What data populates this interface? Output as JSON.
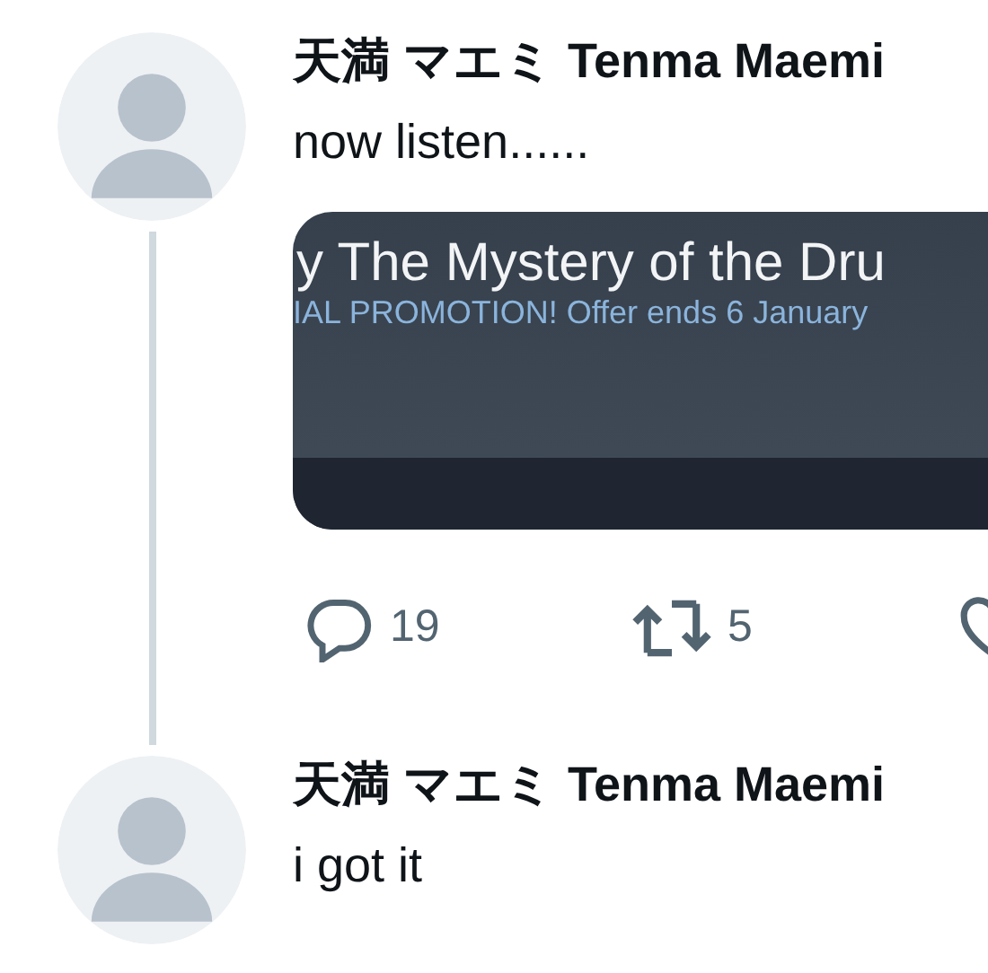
{
  "tweets": [
    {
      "author": "天満 マエミ Tenma Maemi",
      "text": "now listen......",
      "card": {
        "title": "y The Mystery of the Dru",
        "subtitle": "IAL PROMOTION! Offer ends 6 January"
      },
      "actions": [
        {
          "kind": "reply",
          "count": "19"
        },
        {
          "kind": "retweet",
          "count": "5"
        },
        {
          "kind": "like"
        }
      ]
    },
    {
      "author": "天満 マエミ Tenma Maemi",
      "text": "i got it"
    }
  ]
}
